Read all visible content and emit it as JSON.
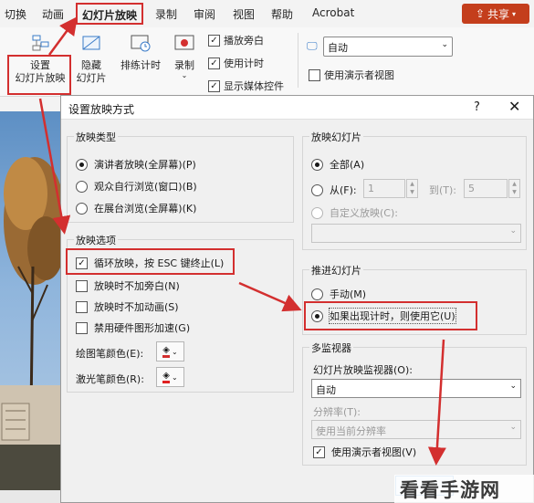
{
  "ribbon_tabs": [
    "切换",
    "动画",
    "幻灯片放映",
    "录制",
    "审阅",
    "视图",
    "帮助",
    "Acrobat"
  ],
  "share_label": "共享",
  "ribbon": {
    "setup_line1": "设置",
    "setup_line2": "幻灯片放映",
    "hide_line1": "隐藏",
    "hide_line2": "幻灯片",
    "rehearse": "排练计时",
    "record": "录制",
    "checks": [
      "播放旁白",
      "使用计时",
      "显示媒体控件"
    ],
    "monitor_value": "自动",
    "presenter_view": "使用演示者视图"
  },
  "dialog": {
    "title": "设置放映方式",
    "help": "?",
    "close": "✕",
    "show_type": {
      "label": "放映类型",
      "options": [
        "演讲者放映(全屏幕)(P)",
        "观众自行浏览(窗口)(B)",
        "在展台浏览(全屏幕)(K)"
      ]
    },
    "show_options": {
      "label": "放映选项",
      "loop": "循环放映，按 ESC 键终止(L)",
      "no_narration": "放映时不加旁白(N)",
      "no_animation": "放映时不加动画(S)",
      "disable_hw": "禁用硬件图形加速(G)",
      "pen_color": "绘图笔颜色(E):",
      "laser_color": "激光笔颜色(R):",
      "pen_hex": "#d32f2f",
      "laser_hex": "#e02020"
    },
    "slides": {
      "label": "放映幻灯片",
      "all": "全部(A)",
      "from": "从(F):",
      "from_value": "1",
      "to": "到(T):",
      "to_value": "5",
      "custom": "自定义放映(C):"
    },
    "advance": {
      "label": "推进幻灯片",
      "manual": "手动(M)",
      "timed": "如果出现计时，则使用它(U)"
    },
    "monitors": {
      "label": "多监视器",
      "monitor_label": "幻灯片放映监视器(O):",
      "monitor_value": "自动",
      "resolution_label": "分辨率(T):",
      "resolution_value": "使用当前分辨率",
      "presenter_view": "使用演示者视图(V)"
    }
  },
  "watermark": "看看手游网",
  "accent_red": "#d32f2f"
}
